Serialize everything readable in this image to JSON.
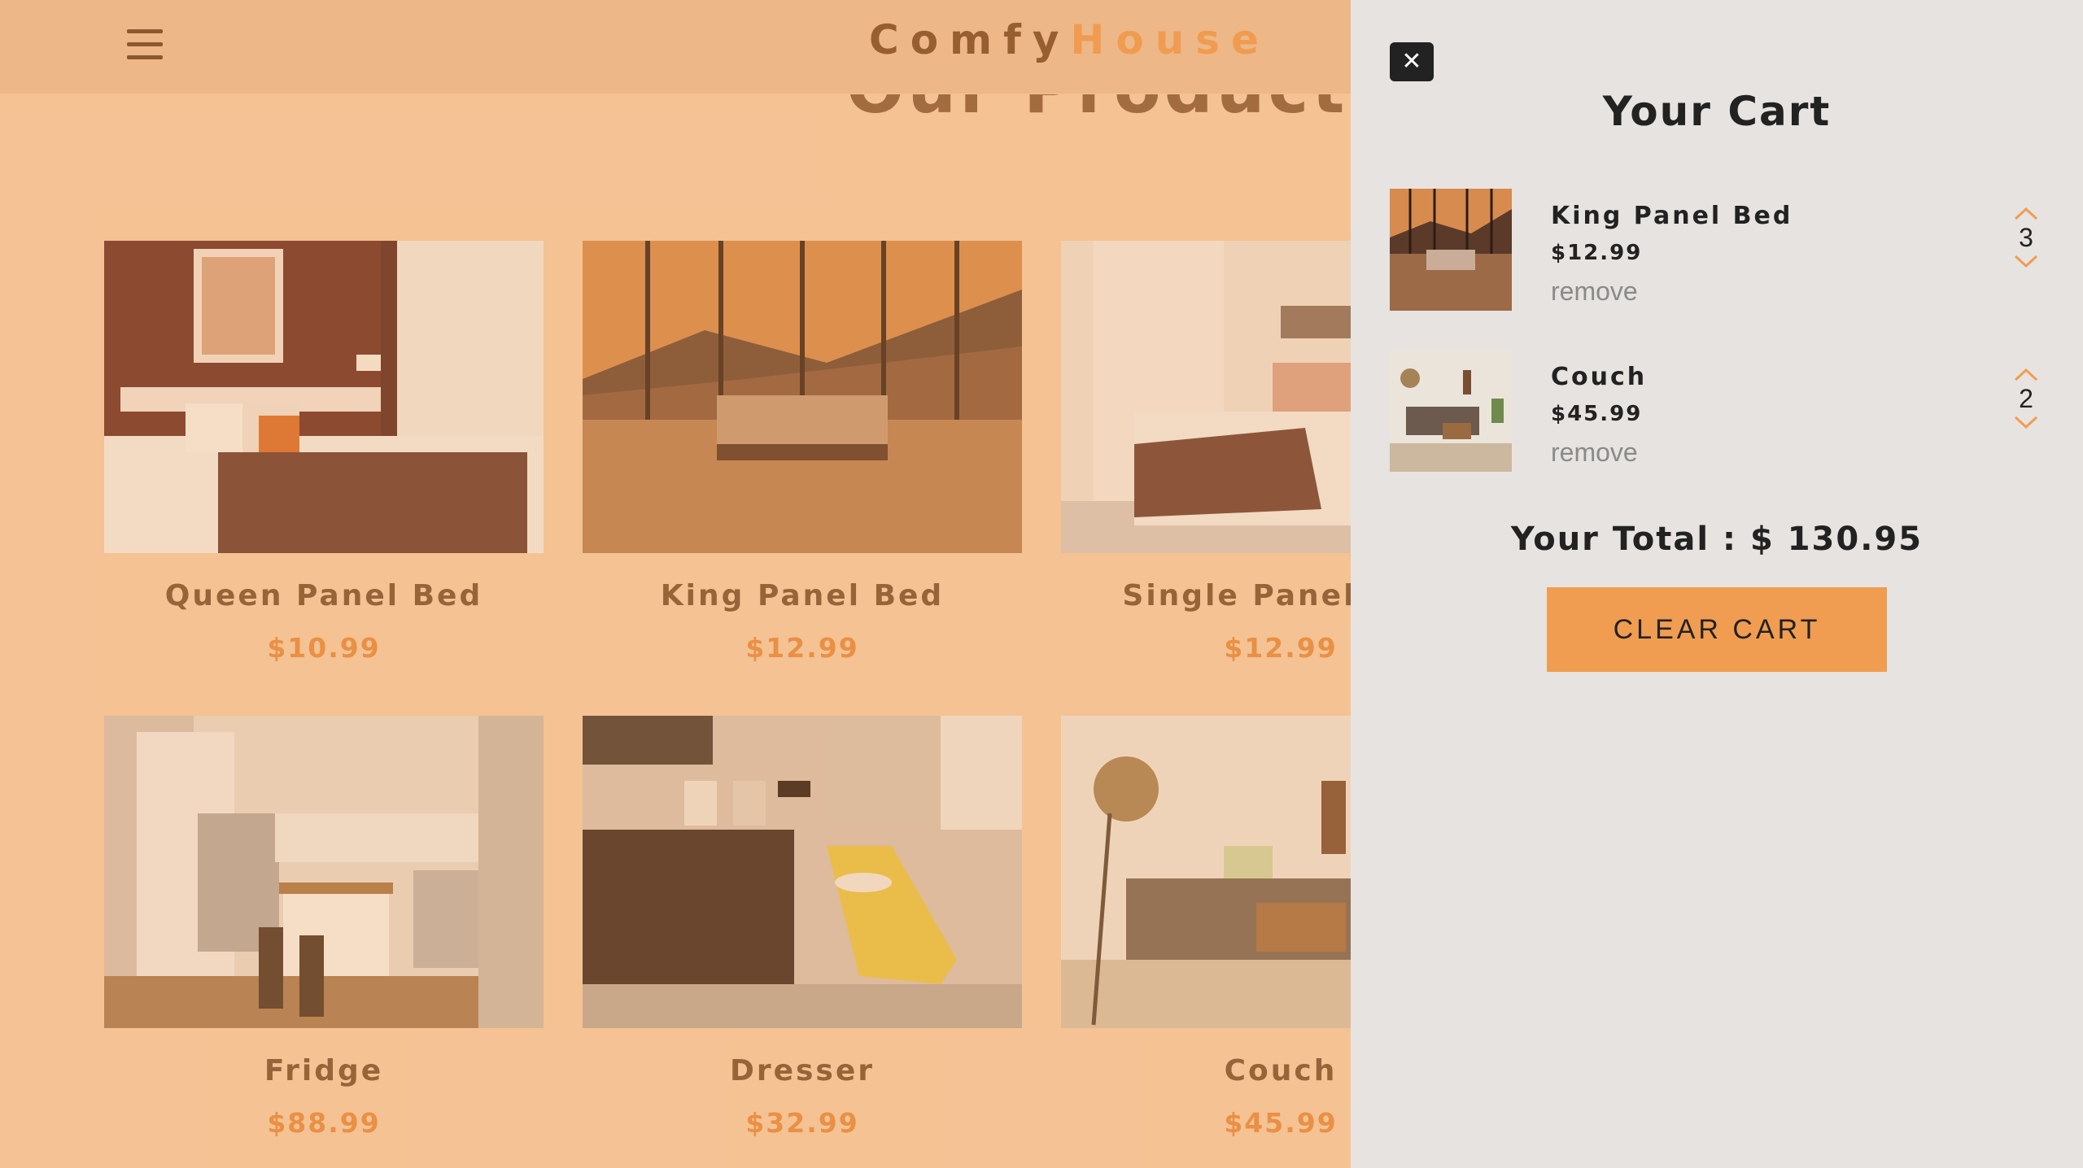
{
  "navbar": {
    "logo_part1": "Comfy",
    "logo_part2": "House"
  },
  "products_section": {
    "title": "Our Products",
    "products": [
      {
        "name": "Queen Panel Bed",
        "price": "$10.99"
      },
      {
        "name": "King Panel Bed",
        "price": "$12.99"
      },
      {
        "name": "Single Panel Bed",
        "price": "$12.99"
      },
      {
        "name": "Fridge",
        "price": "$88.99"
      },
      {
        "name": "Dresser",
        "price": "$32.99"
      },
      {
        "name": "Couch",
        "price": "$45.99"
      }
    ]
  },
  "cart": {
    "close_icon": "close-icon",
    "title": "Your Cart",
    "items": [
      {
        "name": "King Panel Bed",
        "price": "$12.99",
        "remove_label": "remove",
        "quantity": "3"
      },
      {
        "name": "Couch",
        "price": "$45.99",
        "remove_label": "remove",
        "quantity": "2"
      }
    ],
    "total": "Your Total : $ 130.95",
    "clear_label": "CLEAR CART"
  },
  "colors": {
    "primary": "#f09d51",
    "overlay_bg": "#f6cfaa",
    "cart_bg": "#e7e3e0",
    "dark": "#222222"
  }
}
